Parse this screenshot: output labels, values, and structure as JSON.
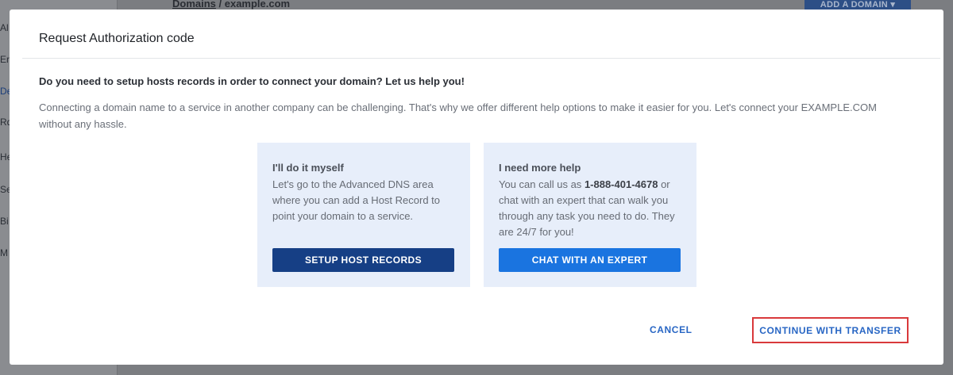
{
  "background": {
    "sidebar_letters": [
      "Al",
      "Er",
      "De",
      "Rd",
      "He",
      "Se",
      "Bi",
      "M"
    ],
    "breadcrumb_link": "Domains",
    "breadcrumb_current": " / example.com",
    "add_domain_label": "ADD A DOMAIN ▾"
  },
  "modal": {
    "title": "Request Authorization code",
    "question": "Do you need to setup hosts records in order to connect your domain? Let us help you!",
    "intro": "Connecting a domain name to a service in another company can be challenging. That's why we offer different help options to make it easier for you. Let's connect your EXAMPLE.COM without any hassle.",
    "cards": {
      "self": {
        "heading": "I'll do it myself",
        "text": "Let's go to the Advanced DNS area where you can add a Host Record to point your domain to a service.",
        "button": "SETUP HOST RECORDS"
      },
      "help": {
        "heading": "I need more help",
        "text_before": "You can call us as ",
        "phone": "1-888-401-4678",
        "text_after": " or chat with an expert that can walk you through any task you need to do. They are 24/7 for you!",
        "button": "CHAT WITH AN EXPERT"
      }
    },
    "cancel_label": "CANCEL",
    "continue_label": "CONTINUE WITH TRANSFER"
  },
  "colors": {
    "primary_dark": "#163f85",
    "primary_bright": "#1a74e0",
    "link": "#2866c4",
    "highlight_border": "#d9393b",
    "card_bg": "#e7eefa"
  }
}
